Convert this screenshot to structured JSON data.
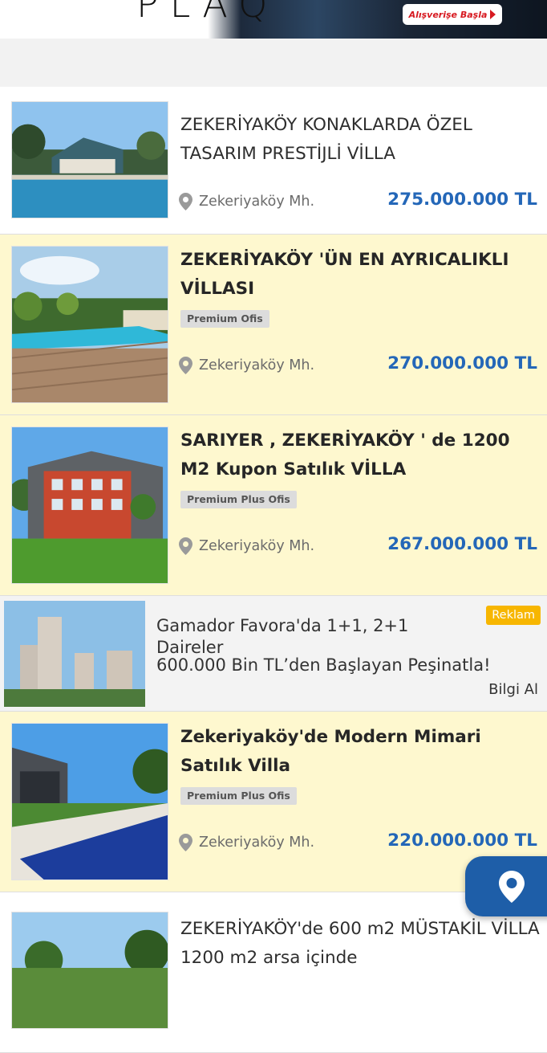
{
  "banner": {
    "cta_label": "Alışverişe Başla"
  },
  "listings": [
    {
      "title": "ZEKERİYAKÖY KONAKLARDA ÖZEL TASARIM PRESTİJLİ VİLLA",
      "location": "Zekeriyaköy Mh.",
      "price": "275.000.000 TL",
      "badge": ""
    },
    {
      "title": "ZEKERİYAKÖY 'ÜN EN AYRICALIKLI VİLLASI",
      "location": "Zekeriyaköy Mh.",
      "price": "270.000.000 TL",
      "badge": "Premium Ofis"
    },
    {
      "title": "SARIYER , ZEKERİYAKÖY ' de 1200 M2 Kupon Satılık VİLLA",
      "location": "Zekeriyaköy Mh.",
      "price": "267.000.000 TL",
      "badge": "Premium Plus Ofis"
    },
    {
      "title": "Zekeriyaköy'de Modern Mimari Satılık Villa",
      "location": "Zekeriyaköy Mh.",
      "price": "220.000.000 TL",
      "badge": "Premium Plus Ofis"
    },
    {
      "title": "ZEKERİYAKÖY'de 600 m2 MÜSTAKİL VİLLA 1200 m2 arsa içinde",
      "location": "",
      "price": "",
      "badge": ""
    }
  ],
  "ad": {
    "tag": "Reklam",
    "title": "Gamador Favora'da 1+1, 2+1 Daireler",
    "subtitle": "600.000 Bin TL’den Başlayan Peşinatla!",
    "info_label": "Bilgi Al"
  },
  "icons": {
    "location_pin": "location-pin-icon",
    "map_fab": "map-pin-icon"
  },
  "colors": {
    "price": "#2467b8",
    "premium_bg": "#fef8cf",
    "ad_tag": "#f7b600",
    "fab": "#1e5ea8"
  }
}
